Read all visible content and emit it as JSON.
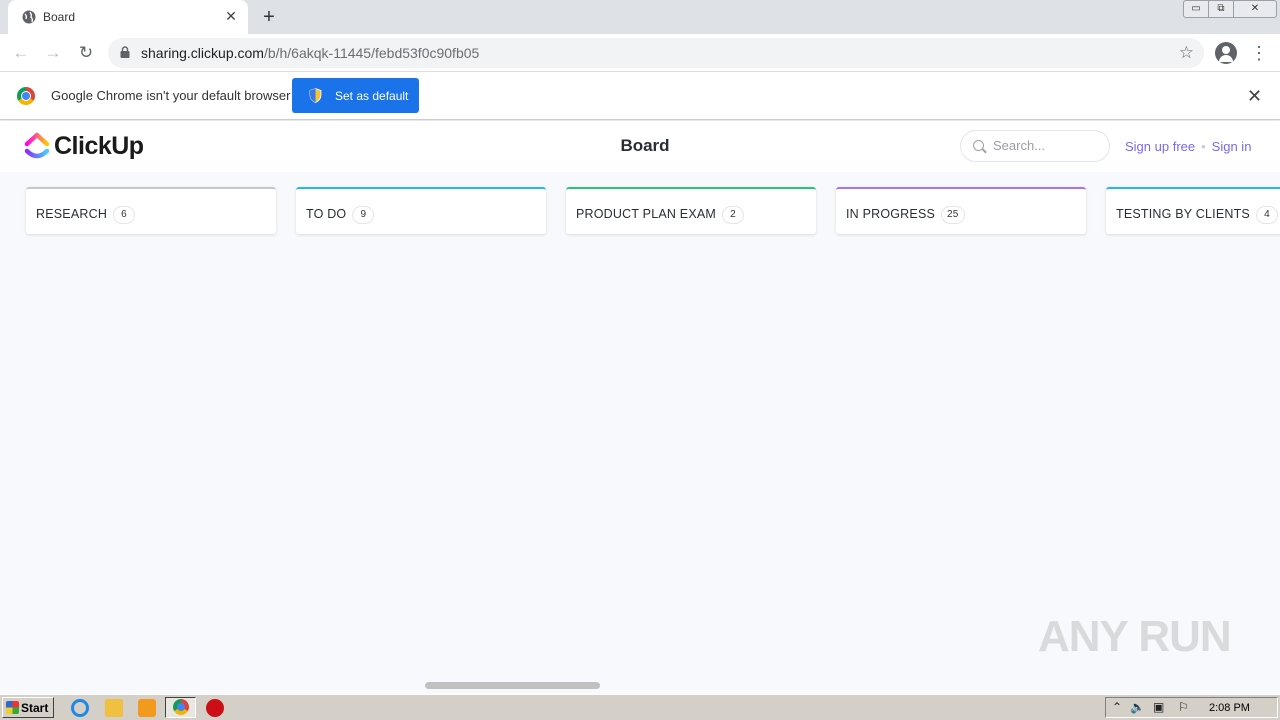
{
  "browser": {
    "tab_title": "Board",
    "new_tab": "+",
    "url_host": "sharing.clickup.com",
    "url_path": "/b/h/6akqk-11445/febd53f0c90fb05"
  },
  "infobar": {
    "message": "Google Chrome isn't your default browser",
    "button_label": "Set as default",
    "close": "✕"
  },
  "app": {
    "logo_text": "ClickUp",
    "page_title": "Board",
    "search_placeholder": "Search...",
    "signup_label": "Sign up free",
    "separator": "•",
    "signin_label": "Sign in"
  },
  "board": {
    "columns": [
      {
        "name": "RESEARCH",
        "count": "6",
        "color": "#c4c8cf"
      },
      {
        "name": "TO DO",
        "count": "9",
        "color": "#2ab6e8"
      },
      {
        "name": "PRODUCT PLAN EXAM",
        "count": "2",
        "color": "#29c27f"
      },
      {
        "name": "IN PROGRESS",
        "count": "25",
        "color": "#a875f0"
      },
      {
        "name": "TESTING BY CLIENTS",
        "count": "4",
        "color": "#2ab6e8"
      }
    ]
  },
  "watermark": "ANY RUN",
  "taskbar": {
    "start_label": "Start",
    "clock": "2:08 PM"
  },
  "colors": {
    "accent": "#7b68ee",
    "chrome_button": "#1a73e8"
  }
}
